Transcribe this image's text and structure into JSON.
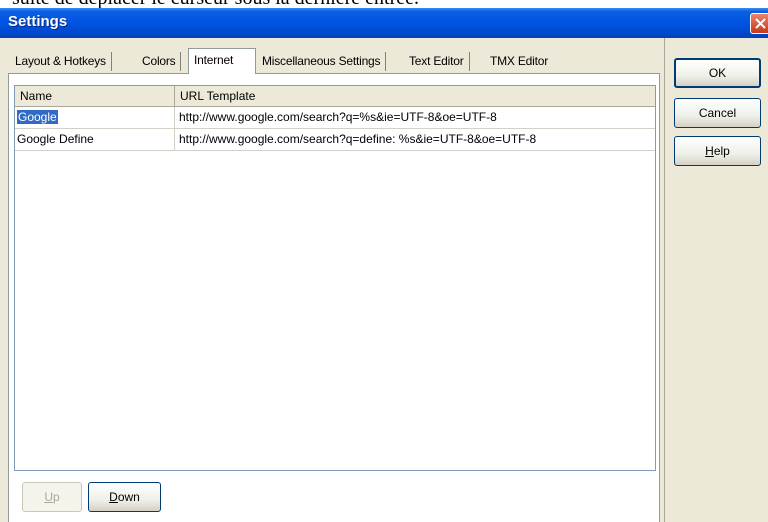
{
  "background_text": "suite de déplacer le curseur sous la dernière entrée.",
  "window": {
    "title": "Settings"
  },
  "tabs": [
    {
      "label": "Layout & Hotkeys",
      "active": false
    },
    {
      "label": "Colors",
      "active": false
    },
    {
      "label": "Internet",
      "active": true
    },
    {
      "label": "Miscellaneous Settings",
      "active": false
    },
    {
      "label": "Text Editor",
      "active": false
    },
    {
      "label": "TMX Editor",
      "active": false
    }
  ],
  "grid": {
    "columns": [
      "Name",
      "URL Template"
    ],
    "rows": [
      {
        "name": "Google",
        "url": "http://www.google.com/search?q=%s&ie=UTF-8&oe=UTF-8",
        "selected": true
      },
      {
        "name": "Google Define",
        "url": "http://www.google.com/search?q=define: %s&ie=UTF-8&oe=UTF-8",
        "selected": false
      }
    ]
  },
  "buttons": {
    "up": {
      "mnemonic": "U",
      "rest": "p",
      "enabled": false
    },
    "down": {
      "mnemonic": "D",
      "rest": "own",
      "enabled": true
    },
    "ok": "OK",
    "cancel": "Cancel",
    "help": {
      "mnemonic": "H",
      "rest": "elp"
    }
  },
  "colors": {
    "titlebar": "#0054e3",
    "selection": "#316ac5",
    "face": "#ece9d8"
  },
  "icons": {
    "close": "close-x-icon"
  }
}
